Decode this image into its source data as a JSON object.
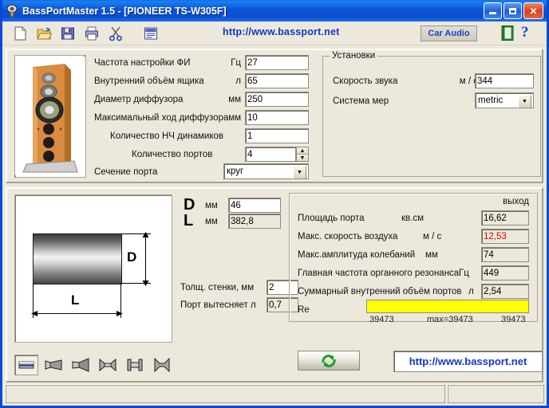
{
  "window": {
    "title": "BassPortMaster 1.5  - [PIONEER TS-W305F]",
    "app_icon": "speaker-icon",
    "minimize_label": "Minimize",
    "maximize_label": "Maximize",
    "close_label": "Close"
  },
  "toolbar": {
    "buttons": [
      {
        "name": "new-file-icon",
        "tip": "New"
      },
      {
        "name": "open-folder-icon",
        "tip": "Open"
      },
      {
        "name": "save-disk-icon",
        "tip": "Save"
      },
      {
        "name": "print-icon",
        "tip": "Print"
      },
      {
        "name": "cut-scissors-icon",
        "tip": "Cut"
      },
      {
        "name": "report-icon",
        "tip": "Report"
      }
    ],
    "url": "http://www.bassport.net",
    "car_audio_label": "Car Audio",
    "notebook_icon": "green-notebook-icon",
    "help_glyph": "?"
  },
  "inputs": {
    "rows": [
      {
        "label": "Частота настройки ФИ",
        "unit": "Гц",
        "value": "27",
        "readonly": false
      },
      {
        "label": "Внутренний объём ящика",
        "unit": "л",
        "value": "65",
        "readonly": false
      },
      {
        "label": "Диаметр диффузора",
        "unit": "мм",
        "value": "250",
        "readonly": false
      },
      {
        "label": "Максимальный ход диффузора",
        "unit": "мм",
        "value": "10",
        "readonly": false
      },
      {
        "label": "Количество НЧ динамиков",
        "unit": "",
        "value": "1",
        "readonly": false
      },
      {
        "label": "Количество портов",
        "unit": "",
        "value": "4",
        "readonly": false,
        "spinner": true
      }
    ],
    "port_section_label": "Сечение порта",
    "port_section_value": "круг"
  },
  "settings": {
    "group_title": "Установки",
    "sound_speed_label": "Скорость звука",
    "sound_speed_unit": "м / с",
    "sound_speed_value": "344",
    "units_label": "Система мер",
    "units_value": "metric"
  },
  "diagram": {
    "label_d": "D",
    "label_l": "L"
  },
  "port": {
    "d_label": "D",
    "d_unit": "мм",
    "d_value": "46",
    "l_label": "L",
    "l_unit": "мм",
    "l_value": "382,8",
    "wall_label": "Толщ. стенки, мм",
    "wall_value": "2",
    "displace_label": "Порт вытесняет л",
    "displace_value": "0,7"
  },
  "output": {
    "header": "выход",
    "rows": [
      {
        "label": "Площадь порта",
        "unit": "кв.см",
        "value": "16,62",
        "red": false
      },
      {
        "label": "Макс. скорость воздуха",
        "unit": "м / с",
        "value": "12,53",
        "red": true
      },
      {
        "label": "Макс.амплитуда колебаний",
        "unit": "мм",
        "value": "74",
        "red": false
      },
      {
        "label": "Главная частота органного резонанса",
        "unit": "Гц",
        "value": "449",
        "red": false
      },
      {
        "label": "Суммарный внутренний объём портов",
        "unit": "л",
        "value": "2,54",
        "red": false
      }
    ],
    "bar_label": "Re",
    "bar_fill_percent": 100,
    "bar_color": "#ffff00",
    "bar_left_text": "39473",
    "bar_center_text": "max=39473",
    "bar_right_text": "39473"
  },
  "shapes": {
    "items": [
      {
        "name": "shape-straight-tube-icon",
        "selected": true
      },
      {
        "name": "shape-cone-icon",
        "selected": false
      },
      {
        "name": "shape-horn-icon",
        "selected": false
      },
      {
        "name": "shape-double-flare-icon",
        "selected": false
      },
      {
        "name": "shape-flanged-tube-icon",
        "selected": false
      },
      {
        "name": "shape-hourglass-icon",
        "selected": false
      }
    ]
  },
  "footer": {
    "refresh_icon": "refresh-recycle-icon",
    "url": "http://www.bassport.net"
  },
  "statusbar": {
    "pane1": "",
    "pane2": ""
  }
}
